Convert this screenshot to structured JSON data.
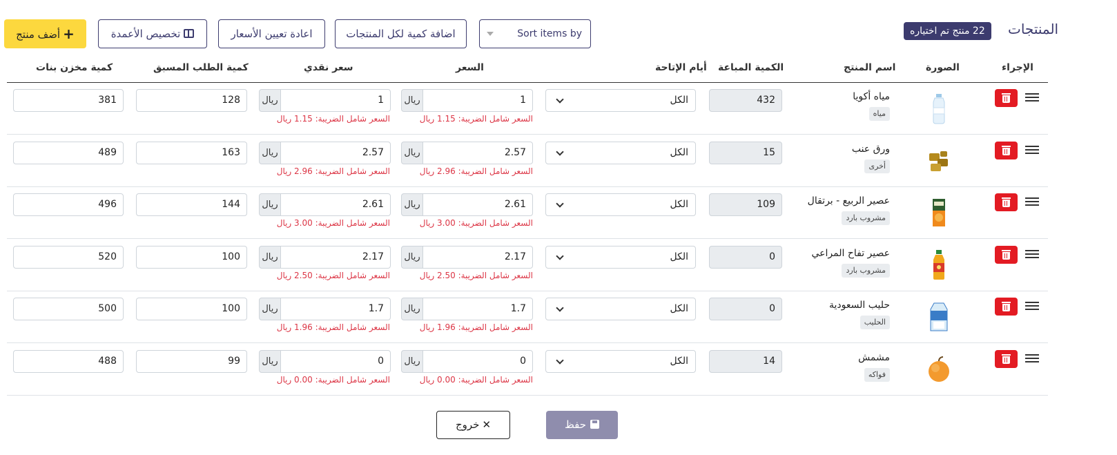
{
  "header": {
    "title": "المنتجات",
    "badge": "22 منتج تم اختياره",
    "sort_placeholder": "Sort items by",
    "add_qty_label": "اضافة كمية لكل المنتجات",
    "reset_prices_label": "اعادة تعيين الأسعار",
    "customize_columns_label": "تخصيص الأعمدة",
    "add_product_label": "أضف منتج"
  },
  "columns": {
    "action": "الإجراء",
    "image": "الصورة",
    "name": "اسم المنتج",
    "sold_qty": "الكمية المباعة",
    "availability_days": "أيام الإتاحة",
    "price": "السعر",
    "cash_price": "سعر نقدي",
    "preorder_qty": "كمية الطلب المسبق",
    "stock_qty": "كمية مخزن بنات"
  },
  "currency": "ريال",
  "rows": [
    {
      "name": "مياه أكويا",
      "category": "مياه",
      "image_icon": "water-bottle-icon",
      "sold": "432",
      "days": "الكل",
      "price": "1",
      "price_note": "السعر شامل الضريبة: 1.15 ريال",
      "cash": "1",
      "cash_note": "السعر شامل الضريبة: 1.15 ريال",
      "preorder": "128",
      "stock": "381"
    },
    {
      "name": "ورق عنب",
      "category": "أخرى",
      "image_icon": "grape-leaves-icon",
      "sold": "15",
      "days": "الكل",
      "price": "2.57",
      "price_note": "السعر شامل الضريبة: 2.96 ريال",
      "cash": "2.57",
      "cash_note": "السعر شامل الضريبة: 2.96 ريال",
      "preorder": "163",
      "stock": "489"
    },
    {
      "name": "عصير الربيع - برتقال",
      "category": "مشروب بارد",
      "image_icon": "orange-juice-box-icon",
      "sold": "109",
      "days": "الكل",
      "price": "2.61",
      "price_note": "السعر شامل الضريبة: 3.00 ريال",
      "cash": "2.61",
      "cash_note": "السعر شامل الضريبة: 3.00 ريال",
      "preorder": "144",
      "stock": "496"
    },
    {
      "name": "عصير تفاح المراعي",
      "category": "مشروب بارد",
      "image_icon": "apple-juice-bottle-icon",
      "sold": "0",
      "days": "الكل",
      "price": "2.17",
      "price_note": "السعر شامل الضريبة: 2.50 ريال",
      "cash": "2.17",
      "cash_note": "السعر شامل الضريبة: 2.50 ريال",
      "preorder": "100",
      "stock": "520"
    },
    {
      "name": "حليب السعودية",
      "category": "الحليب",
      "image_icon": "milk-carton-icon",
      "sold": "0",
      "days": "الكل",
      "price": "1.7",
      "price_note": "السعر شامل الضريبة: 1.96 ريال",
      "cash": "1.7",
      "cash_note": "السعر شامل الضريبة: 1.96 ريال",
      "preorder": "100",
      "stock": "500"
    },
    {
      "name": "مشمش",
      "category": "فواكه",
      "image_icon": "apricot-icon",
      "sold": "14",
      "days": "الكل",
      "price": "0",
      "price_note": "السعر شامل الضريبة: 0.00 ريال",
      "cash": "0",
      "cash_note": "السعر شامل الضريبة: 0.00 ريال",
      "preorder": "99",
      "stock": "488"
    }
  ],
  "footer": {
    "save_label": "حفظ",
    "exit_label": "خروج"
  },
  "colors": {
    "primary": "#3c3b6e",
    "accent_yellow": "#fcd83e",
    "danger": "#e31b23",
    "note_red": "#dc3545",
    "save_disabled": "#8f8dad"
  }
}
